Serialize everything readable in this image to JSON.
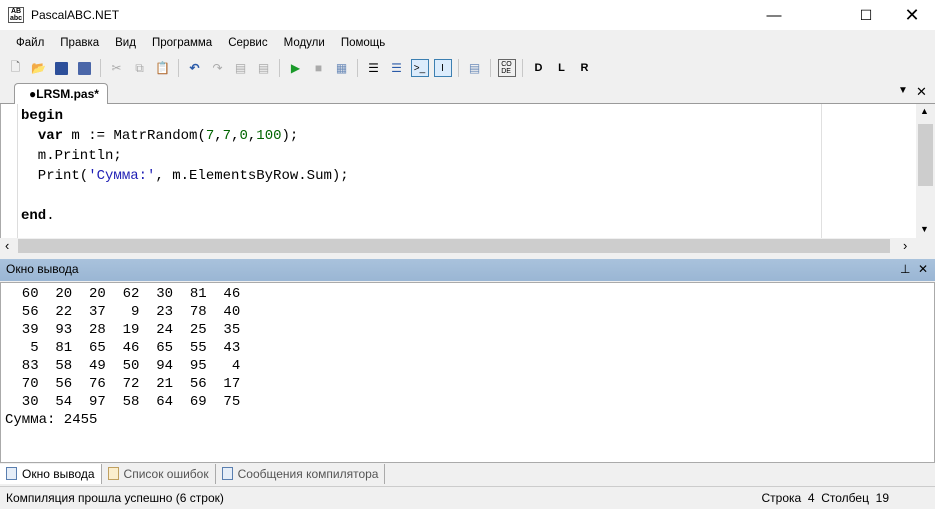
{
  "window": {
    "title": "PascalABC.NET",
    "icon_text": "AB abc"
  },
  "menu": [
    "Файл",
    "Правка",
    "Вид",
    "Программа",
    "Сервис",
    "Модули",
    "Помощь"
  ],
  "toolbar": [
    "new-file",
    "open",
    "save",
    "save-all",
    "cut",
    "copy",
    "paste",
    "undo",
    "redo",
    "unindent",
    "indent",
    "run",
    "stop",
    "debug",
    "comment",
    "uncomment",
    "output-console",
    "output-text",
    "format",
    "code-templates",
    "refs-d",
    "refs-l",
    "refs-r"
  ],
  "editor": {
    "tab": "●LRSM.pas*",
    "lines": [
      [
        {
          "t": "begin",
          "c": "kw"
        }
      ],
      [
        {
          "t": "  "
        },
        {
          "t": "var",
          "c": "kw"
        },
        {
          "t": " m := MatrRandom("
        },
        {
          "t": "7",
          "c": "num"
        },
        {
          "t": ","
        },
        {
          "t": "7",
          "c": "num"
        },
        {
          "t": ","
        },
        {
          "t": "0",
          "c": "num"
        },
        {
          "t": ","
        },
        {
          "t": "100",
          "c": "num"
        },
        {
          "t": ");"
        }
      ],
      [
        {
          "t": "  m.Println;"
        }
      ],
      [
        {
          "t": "  Print("
        },
        {
          "t": "'Сумма:'",
          "c": "str"
        },
        {
          "t": ", m.ElementsByRow.Sum);"
        }
      ],
      [
        {
          "t": ""
        }
      ],
      [
        {
          "t": "end",
          "c": "kw"
        },
        {
          "t": "."
        }
      ]
    ]
  },
  "output": {
    "title": "Окно вывода",
    "matrix": [
      [
        60,
        20,
        20,
        62,
        30,
        81,
        46
      ],
      [
        56,
        22,
        37,
        9,
        23,
        78,
        40
      ],
      [
        39,
        93,
        28,
        19,
        24,
        25,
        35
      ],
      [
        5,
        81,
        65,
        46,
        65,
        55,
        43
      ],
      [
        83,
        58,
        49,
        50,
        94,
        95,
        4
      ],
      [
        70,
        56,
        76,
        72,
        21,
        56,
        17
      ],
      [
        30,
        54,
        97,
        58,
        64,
        69,
        75
      ]
    ],
    "sum_line": "Сумма: 2455"
  },
  "bottom_tabs": [
    "Окно вывода",
    "Список ошибок",
    "Сообщения компилятора"
  ],
  "status": {
    "message": "Компиляция прошла успешно (6 строк)",
    "row_label": "Строка",
    "row": "4",
    "col_label": "Столбец",
    "col": "19"
  }
}
